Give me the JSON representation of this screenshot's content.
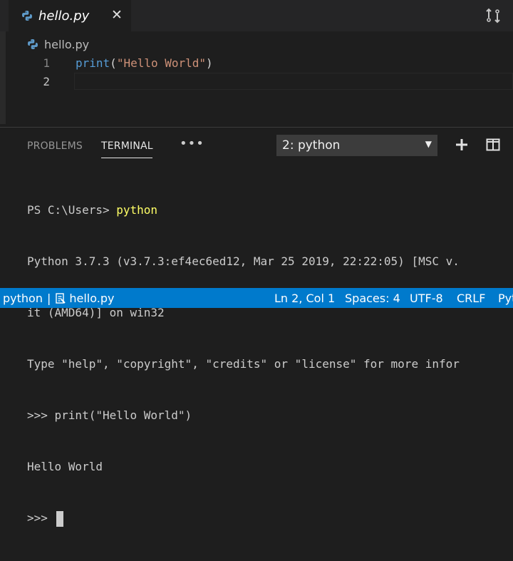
{
  "tab": {
    "filename": "hello.py",
    "close": "✕"
  },
  "breadcrumb": {
    "file": "hello.py"
  },
  "editor": {
    "lines": [
      {
        "num": "1",
        "fn": "print",
        "open": "(",
        "str": "\"Hello World\"",
        "close": ")"
      },
      {
        "num": "2"
      }
    ]
  },
  "panel": {
    "tabs": {
      "problems": "PROBLEMS",
      "terminal": "TERMINAL",
      "more": "•••"
    },
    "terminal_select": "2: python",
    "terminal": {
      "l1_prompt": "PS C:\\Users> ",
      "l1_cmd": "python",
      "l2": "Python 3.7.3 (v3.7.3:ef4ec6ed12, Mar 25 2019, 22:22:05) [MSC v.",
      "l3": "it (AMD64)] on win32",
      "l4": "Type \"help\", \"copyright\", \"credits\" or \"license\" for more infor",
      "l5": ">>> print(\"Hello World\")",
      "l6": "Hello World",
      "l7": ">>> "
    }
  },
  "statusbar": {
    "lang_left": "python",
    "sep": "|",
    "file": "hello.py",
    "position": "Ln 2, Col 1",
    "spaces": "Spaces: 4",
    "encoding": "UTF-8",
    "eol": "CRLF",
    "lang_right": "Pyt"
  },
  "colors": {
    "statusbar": "#007acc",
    "keyword": "#569cd6",
    "string": "#ce9178",
    "command": "#ffff66"
  }
}
